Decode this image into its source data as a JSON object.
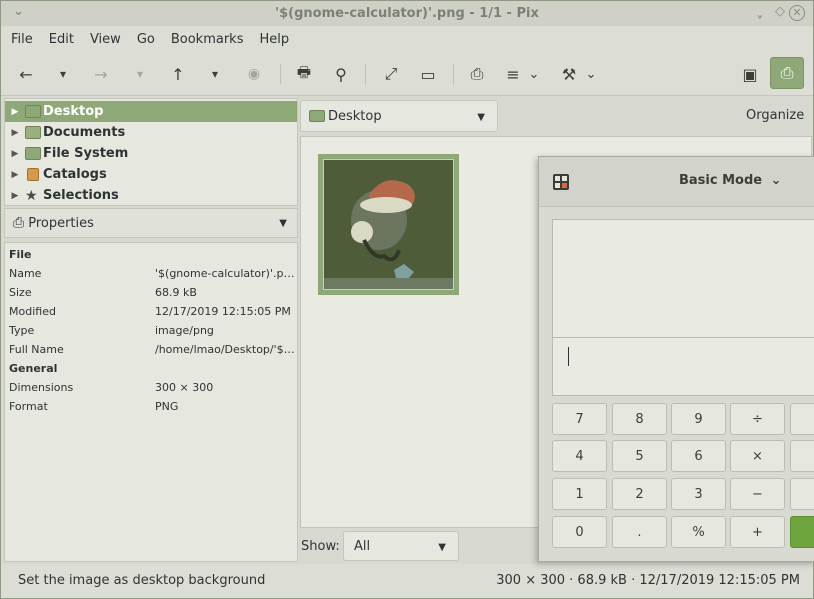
{
  "window": {
    "title": "'$(gnome-calculator)'.png - 1/1 - Pix",
    "controls": [
      "⌄",
      "ˬ",
      "◇",
      "✕"
    ]
  },
  "menubar": [
    "File",
    "Edit",
    "View",
    "Go",
    "Bookmarks",
    "Help"
  ],
  "toolbar": {
    "back": "←",
    "back_dd": "▾",
    "forward": "→",
    "forward_dd": "▾",
    "up": "↑",
    "up_dd": "▾",
    "stop": "◉",
    "print": "🖶",
    "find": "⚲",
    "fullscreen": "⤢",
    "slideshow": "▭",
    "properties": "⎙",
    "menu": "≡",
    "menu_dd": "⌄",
    "tools": "⚒",
    "tools_dd": "⌄",
    "image_view": "▣",
    "browser_view": "⎙"
  },
  "tree": {
    "items": [
      {
        "label": "Desktop",
        "icon": "folder-green",
        "selected": true
      },
      {
        "label": "Documents",
        "icon": "folder-documents"
      },
      {
        "label": "File System",
        "icon": "folder-green"
      },
      {
        "label": "Catalogs",
        "icon": "catalog"
      },
      {
        "label": "Selections",
        "icon": "star"
      }
    ]
  },
  "properties": {
    "title": "Properties",
    "rows": [
      {
        "k": "File",
        "v": "",
        "head": true
      },
      {
        "k": "Name",
        "v": "'$(gnome-calculator)'.png"
      },
      {
        "k": "Size",
        "v": "68.9 kB"
      },
      {
        "k": "Modified",
        "v": "12/17/2019 12:15:05 PM"
      },
      {
        "k": "Type",
        "v": "image/png"
      },
      {
        "k": "Full Name",
        "v": "/home/lmao/Desktop/'$(g..."
      },
      {
        "k": "General",
        "v": "",
        "head": true
      },
      {
        "k": "Dimensions",
        "v": "300 × 300"
      },
      {
        "k": "Format",
        "v": "PNG"
      }
    ]
  },
  "location": {
    "value": "Desktop",
    "organize": "Organize"
  },
  "filter": {
    "label": "Show:",
    "value": "All"
  },
  "status": {
    "left": "Set the image as desktop background",
    "right": "300 × 300 · 68.9 kB · 12/17/2019 12:15:05 PM"
  },
  "calculator": {
    "mode": "Basic Mode",
    "mode_dd": "⌄",
    "keys": [
      [
        "7",
        "8",
        "9",
        "÷"
      ],
      [
        "4",
        "5",
        "6",
        "×"
      ],
      [
        "1",
        "2",
        "3",
        "−"
      ],
      [
        "0",
        ".",
        "%",
        "+"
      ]
    ]
  },
  "colors": {
    "accent": "#8fa878",
    "calc_equals": "#6ea53e"
  }
}
